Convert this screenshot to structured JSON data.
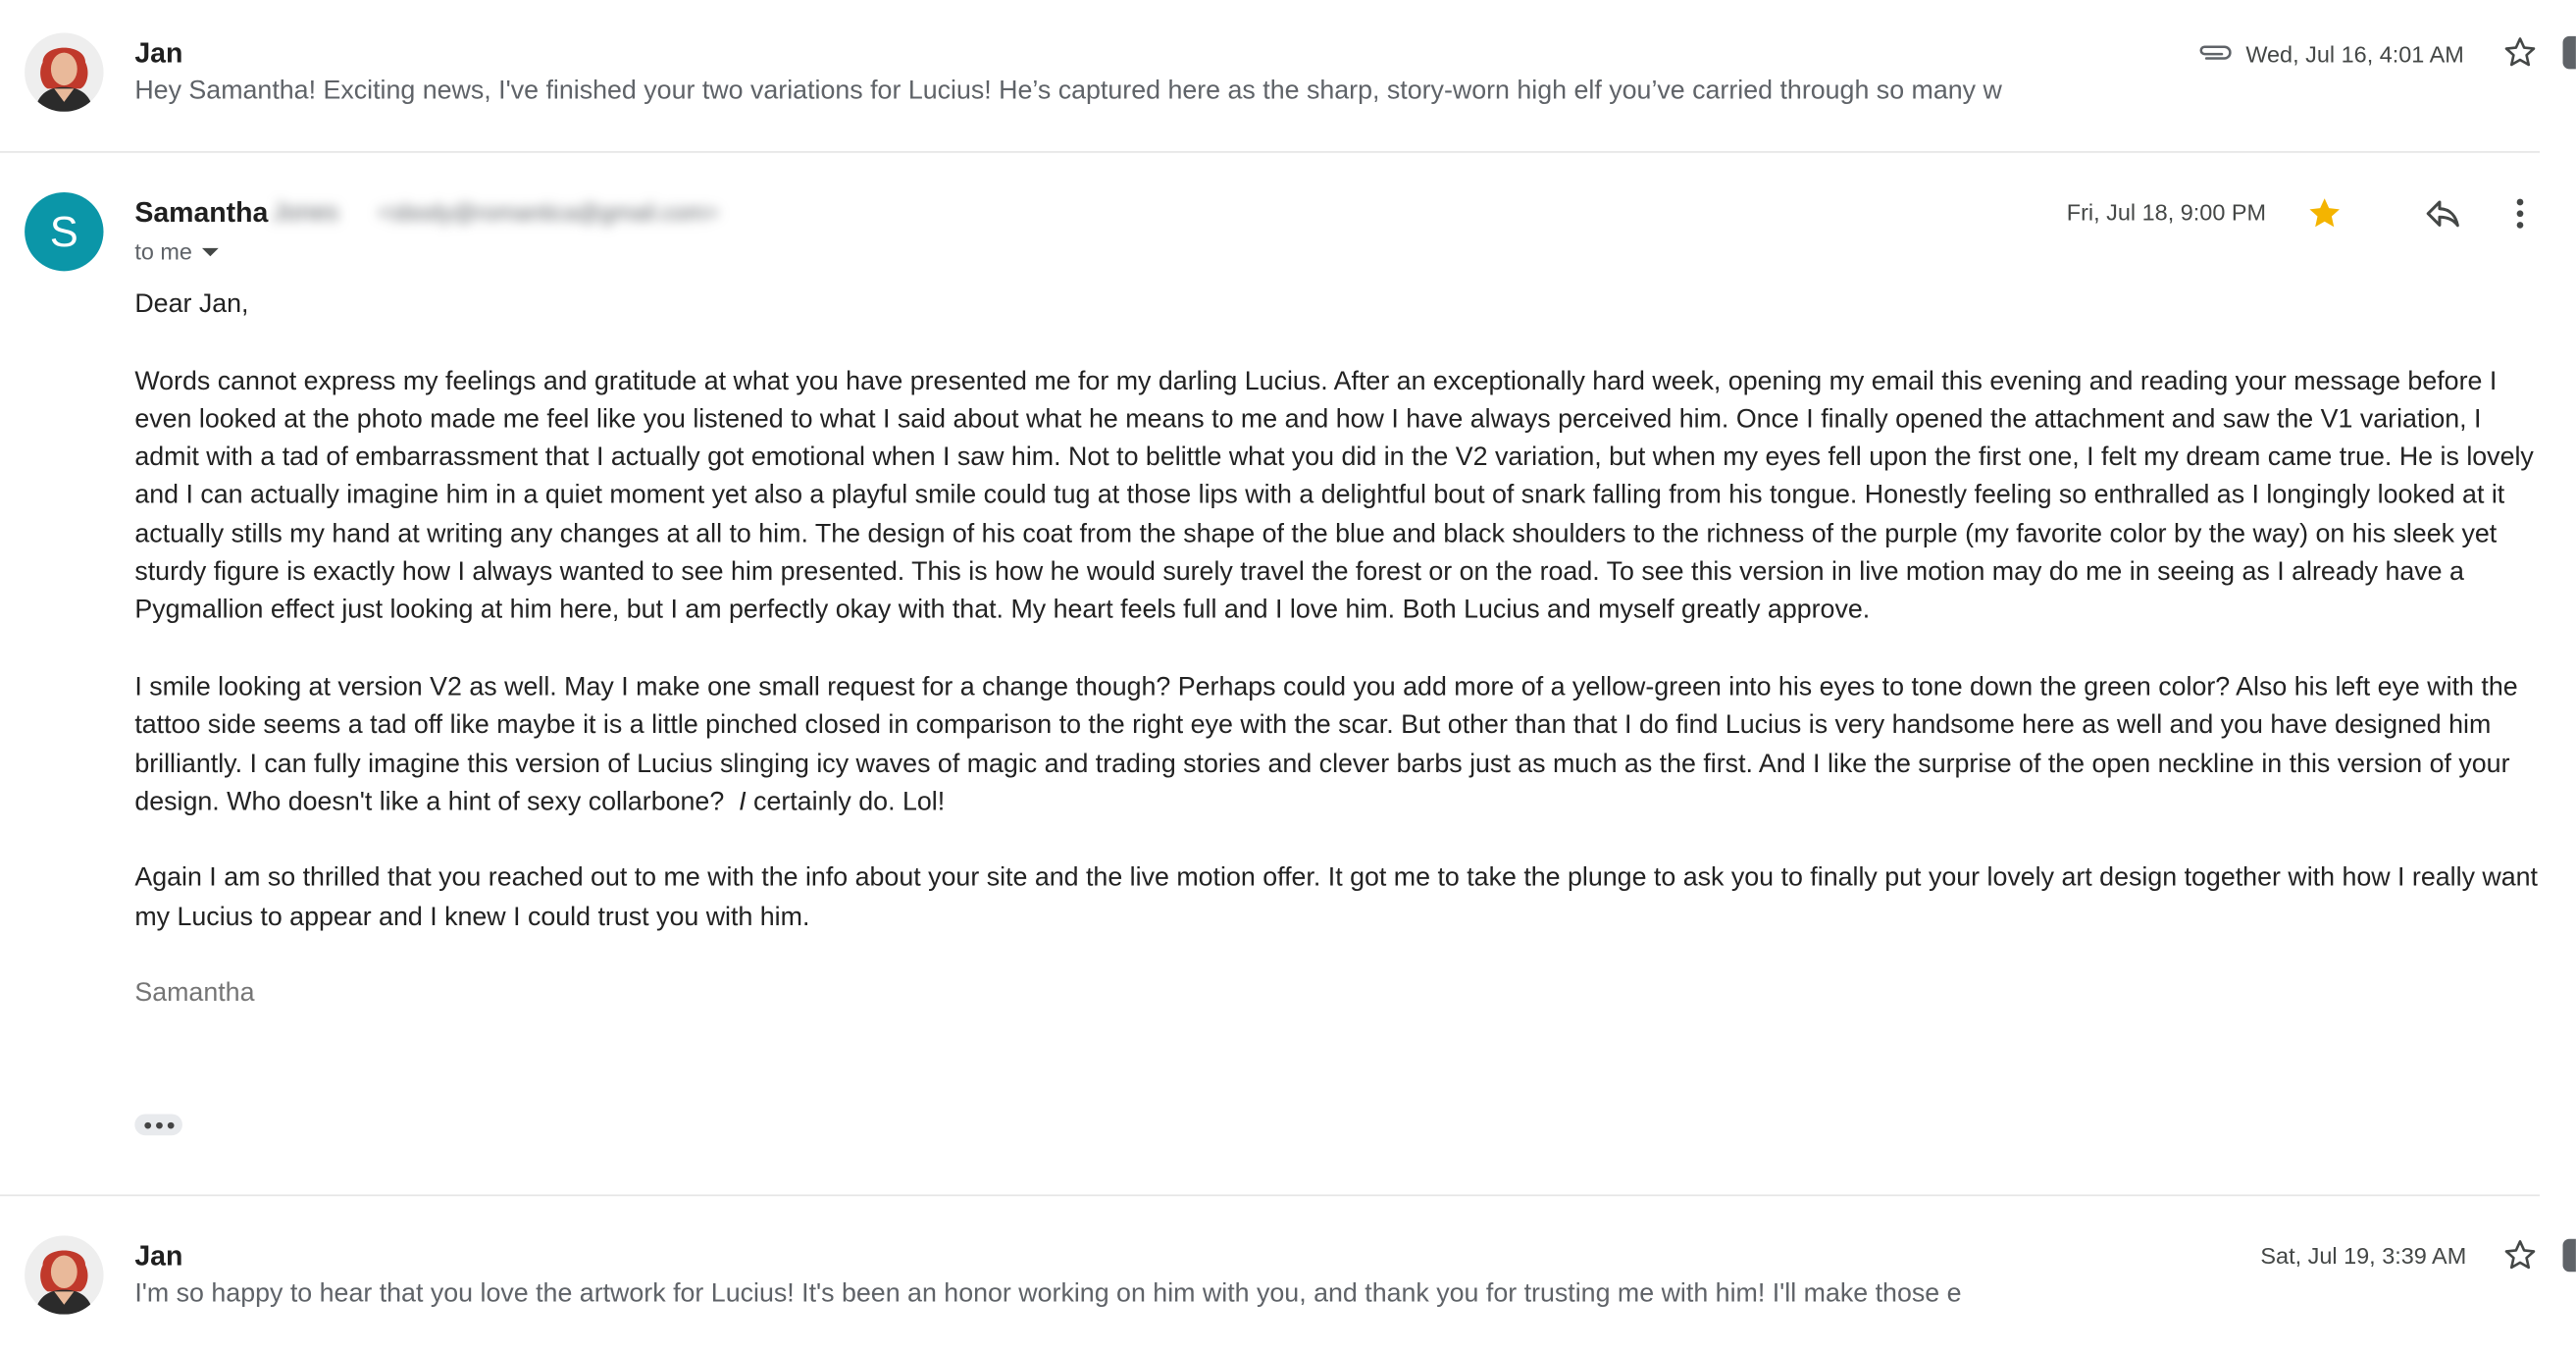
{
  "thread": [
    {
      "sender": "Jan",
      "snippet": "Hey Samantha! Exciting news, I've finished your two variations for Lucius! He’s captured here as the sharp, story-worn high elf you’ve carried through so many w",
      "date": "Wed, Jul 16, 4:01 AM",
      "has_attachment": true
    },
    {
      "sender": "Samantha",
      "sender_lastname_blurred": "Jones",
      "email_blurred": "<sbody@romantica@gmail.com>",
      "recipient": "to me",
      "date": "Fri, Jul 18, 9:00 PM",
      "avatar_letter": "S",
      "avatar_color": "#0b96a8",
      "starred": true,
      "star_color": "#f4b400",
      "greeting": "Dear Jan,",
      "paragraph1": "Words cannot express my feelings and gratitude at what you have presented me for my darling Lucius.  After an exceptionally hard week, opening my email this evening and reading your message before I even looked at the photo made me feel like you listened to what I said about what he means to me and how I have always perceived him.  Once I finally opened the attachment and saw the V1 variation, I admit with a tad of embarrassment that I actually got emotional when I saw him.  Not to belittle what you did in the V2 variation, but when my eyes fell upon the first one, I felt my dream came true.  He is lovely and I can actually imagine him in a quiet moment yet also a playful smile could tug at those lips with a delightful bout of snark falling from his tongue.  Honestly feeling so enthralled as I longingly looked at it actually stills my hand at writing any changes at all to him.  The design of his coat from the shape of the blue and black shoulders to the richness of the purple (my favorite color by the way) on his sleek yet sturdy figure is exactly how I always wanted to see him presented.  This is how he would surely travel the forest or on the road.  To see this version in live motion may do me in seeing as I already have a Pygmallion effect just looking at him here, but I am perfectly okay with that.  My heart feels full and I love him.  Both Lucius and myself greatly approve.",
      "paragraph2_start": "I smile looking at version V2 as well.  May I make one small request for a change though?  Perhaps could you add more of a yellow-green into his eyes to tone down the green color?  Also his left eye with the tattoo side seems a tad off like maybe it is a little pinched closed in comparison to the right eye with the scar.  But other than that I do find Lucius is very handsome here as well and you have designed him brilliantly.  I can fully imagine this version of Lucius slinging icy waves of magic and trading stories and clever barbs just as much as the first.  And I like the surprise of the open neckline in this version of your design.  Who doesn't like a hint of sexy collarbone?",
      "paragraph2_italic": "I",
      "paragraph2_end": " certainly do.  Lol!",
      "paragraph3": "Again I am so thrilled that you reached out to me with the info about your site and the live motion offer.  It got me to take the plunge to ask you to finally put your lovely art design together with how I really want my Lucius to appear and I knew I could trust you with him.",
      "signature": "Samantha"
    },
    {
      "sender": "Jan",
      "snippet": "I'm so happy to hear that you love the artwork for Lucius! It's been an honor working on him with you, and thank you for trusting me with him! I'll make those e",
      "date": "Sat, Jul 19, 3:39 AM"
    }
  ],
  "icons": {
    "attachment": "paperclip-icon",
    "star": "star-icon",
    "reply": "reply-icon",
    "more": "more-vert-icon",
    "expand": "show-trimmed-content-icon",
    "dropdown": "chevron-down-icon"
  }
}
